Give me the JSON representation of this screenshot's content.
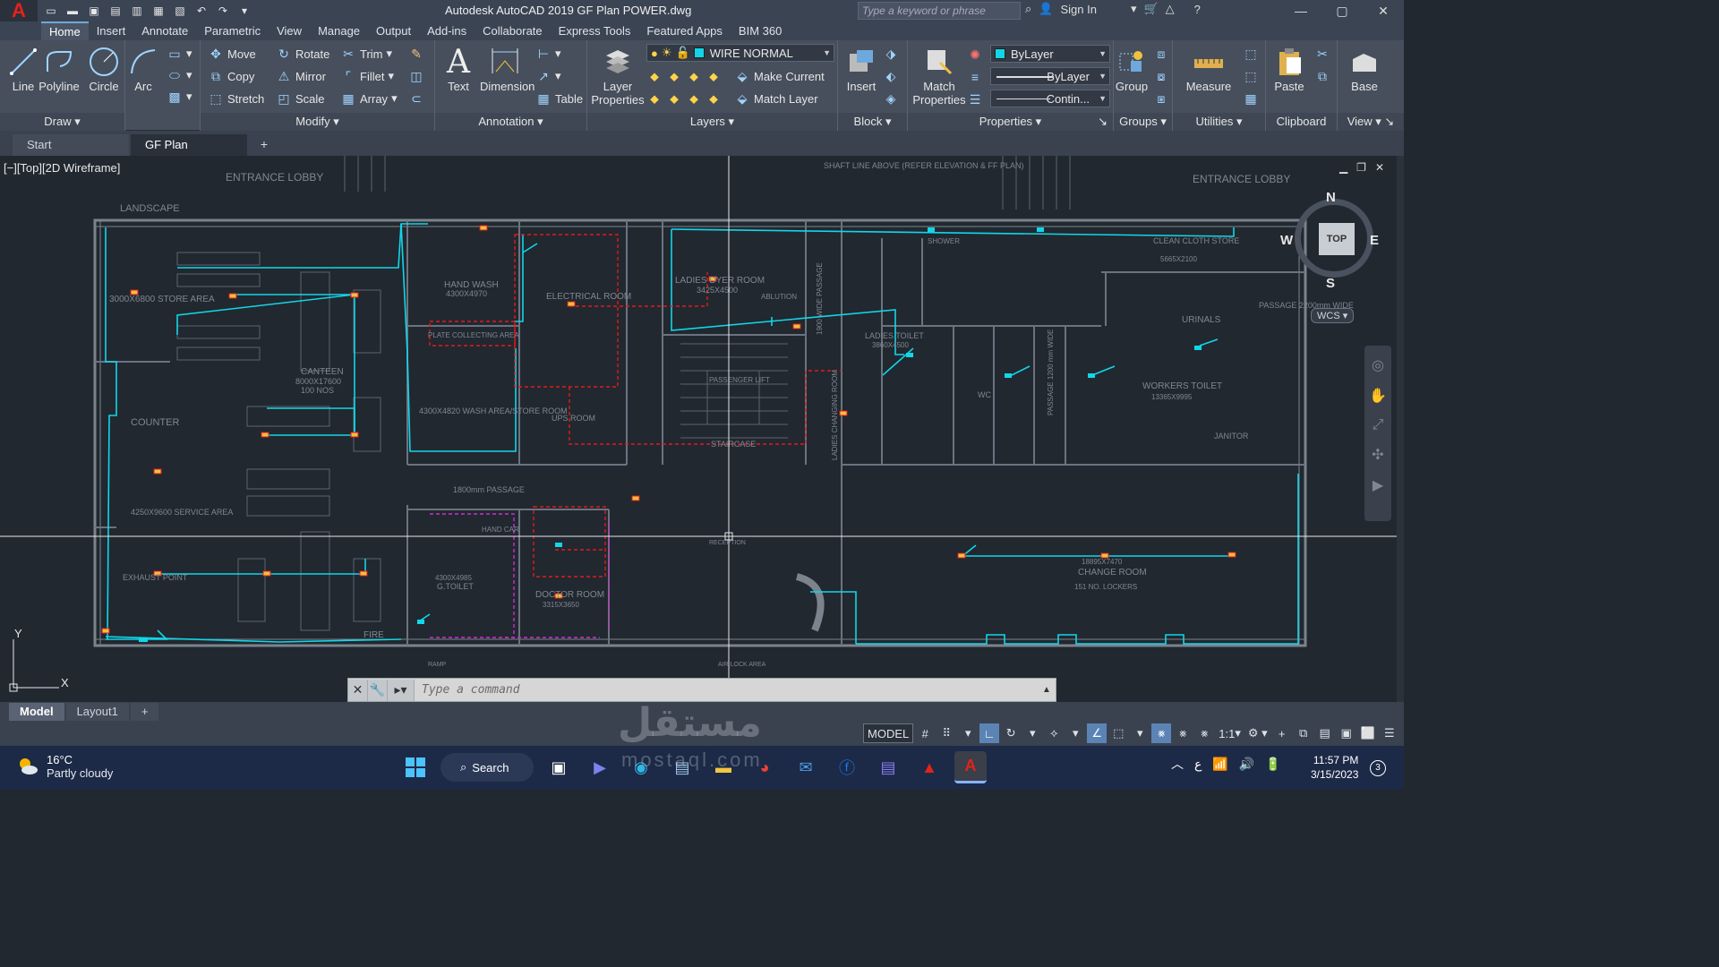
{
  "titlebar": {
    "app_logo": "A",
    "title": "Autodesk AutoCAD 2019   GF Plan POWER.dwg",
    "search_placeholder": "Type a keyword or phrase",
    "sign_in": "Sign In"
  },
  "ribbon_tabs": [
    "Home",
    "Insert",
    "Annotate",
    "Parametric",
    "View",
    "Manage",
    "Output",
    "Add-ins",
    "Collaborate",
    "Express Tools",
    "Featured Apps",
    "BIM 360"
  ],
  "ribbon": {
    "draw": {
      "title": "Draw",
      "line": "Line",
      "polyline": "Polyline",
      "circle": "Circle",
      "arc": "Arc"
    },
    "modify": {
      "title": "Modify",
      "move": "Move",
      "rotate": "Rotate",
      "trim": "Trim",
      "copy": "Copy",
      "mirror": "Mirror",
      "fillet": "Fillet",
      "stretch": "Stretch",
      "scale": "Scale",
      "array": "Array"
    },
    "annotation": {
      "title": "Annotation",
      "text": "Text",
      "dimension": "Dimension",
      "table": "Table"
    },
    "layers": {
      "title": "Layers",
      "layer_properties": "Layer Properties",
      "current_layer": "WIRE NORMAL",
      "make_current": "Make Current",
      "match_layer": "Match Layer"
    },
    "block": {
      "title": "Block",
      "insert": "Insert"
    },
    "properties": {
      "title": "Properties",
      "match_properties": "Match Properties",
      "color": "ByLayer",
      "lineweight": "ByLayer",
      "linetype": "Contin..."
    },
    "groups": {
      "title": "Groups",
      "group": "Group"
    },
    "utilities": {
      "title": "Utilities",
      "measure": "Measure"
    },
    "clipboard": {
      "title": "Clipboard",
      "paste": "Paste"
    },
    "view": {
      "title": "View",
      "base": "Base"
    }
  },
  "file_tabs": [
    "Start",
    "GF Plan POWER*"
  ],
  "viewport": {
    "label": "[−][Top][2D Wireframe]",
    "viewcube": {
      "top": "TOP",
      "n": "N",
      "s": "S",
      "e": "E",
      "w": "W",
      "wcs": "WCS"
    },
    "ucs": {
      "x": "X",
      "y": "Y"
    }
  },
  "drawing_labels": {
    "entrance_lobby_1": "ENTRANCE LOBBY",
    "entrance_lobby_2": "ENTRANCE LOBBY",
    "landscape": "LANDSCAPE",
    "store_area": "3000X6800 STORE AREA",
    "canteen": "CANTEEN",
    "canteen_dim": "8000X17600",
    "canteen_pax": "100 NOS",
    "counter": "COUNTER",
    "service_area": "4250X9600 SERVICE AREA",
    "exhaust_point": "EXHAUST POINT",
    "hand_wash": "HAND WASH",
    "hand_wash_dim": "4300X4970",
    "plate_collecting": "PLATE COLLECTING AREA",
    "wash_area": "4300X4820 WASH AREA/STORE ROOM",
    "passage_1800": "1800mm PASSAGE",
    "electrical_room": "ELECTRICAL ROOM",
    "ups_room": "UPS ROOM",
    "ladies_dyer": "LADIES DYER ROOM",
    "ladies_dyer_dim": "3425X4500",
    "ablution": "ABLUTION",
    "passage_1900": "1900 WIDE PASSAGE",
    "staircase": "STAIRCASE",
    "passenger_lift": "PASSENGER LIFT",
    "shaft_line": "SHAFT LINE ABOVE (REFER ELEVATION & FF PLAN)",
    "shower": "SHOWER",
    "ladies_toilet": "LADIES TOILET",
    "ladies_toilet_dim": "3860X4500",
    "ladies_changing": "LADIES CHANGING ROOM",
    "clean_cloth": "CLEAN CLOTH STORE",
    "clean_cloth_dim": "5665X2100",
    "urinals": "URINALS",
    "passage_2200": "PASSAGE 2200mm WIDE",
    "workers_toilet": "WORKERS TOILET",
    "workers_toilet_dim": "13365X9995",
    "janitor": "JANITOR",
    "wc": "WC",
    "change_room": "CHANGE ROOM",
    "change_room_dim": "18895X7470",
    "lockers": "151 NO. LOCKERS",
    "doctor_room": "DOCTOR ROOM",
    "doctor_room_dim": "3315X3650",
    "g_toilet": "G.TOILET",
    "g_toilet_dim": "4300X4985",
    "fire": "FIRE",
    "ramp": "RAMP",
    "reception": "RECEPTION",
    "air_lock": "AIR LOCK AREA",
    "passage_1200": "PASSAGE 1200 mm WIDE",
    "hand_car": "HAND CAR"
  },
  "command_line": {
    "placeholder": "Type a command"
  },
  "layout_tabs": [
    "Model",
    "Layout1"
  ],
  "status_bar": {
    "model": "MODEL",
    "scale": "1:1"
  },
  "taskbar": {
    "temp": "16°C",
    "weather": "Partly cloudy",
    "search": "Search",
    "time": "11:57 PM",
    "date": "3/15/2023",
    "lang": "ع",
    "notifications": "3"
  },
  "watermark": {
    "main": "مستقل",
    "sub": "mostaql.com"
  },
  "colors": {
    "cyan_wire": "#12d6e8",
    "red_wire": "#e21b1b",
    "magenta": "#d12ad1",
    "walls": "#6e7681",
    "background": "#212830"
  }
}
